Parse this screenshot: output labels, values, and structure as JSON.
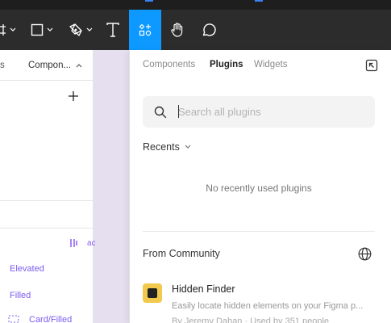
{
  "left_panel": {
    "tab_partial": "s",
    "tab_components": "Compon...",
    "assets_partial": "ac",
    "items": [
      "Elevated",
      "Filled",
      "Card/Filled"
    ]
  },
  "plugins_panel": {
    "tabs": [
      {
        "label": "Components",
        "active": false
      },
      {
        "label": "Plugins",
        "active": true
      },
      {
        "label": "Widgets",
        "active": false
      }
    ],
    "search": {
      "placeholder": "Search all plugins",
      "value": ""
    },
    "recents": {
      "label": "Recents",
      "empty_message": "No recently used plugins"
    },
    "community": {
      "label": "From Community",
      "plugins": [
        {
          "name": "Hidden Finder",
          "description": "Easily locate hidden elements on your Figma p...",
          "byline": "By Jeremy Dahan · Used by 351 people"
        }
      ]
    }
  },
  "colors": {
    "toolbar_bg": "#2c2c2c",
    "active_tool": "#0d99ff",
    "canvas": "#e6dff0",
    "component_purple": "#7c5cf0",
    "plugin_icon": "#f2c94c"
  },
  "icons": {
    "toolbar": [
      "frame-icon",
      "rectangle-icon",
      "pen-icon",
      "text-icon",
      "resources-icon",
      "hand-icon",
      "comment-icon"
    ],
    "panel": [
      "expand-icon",
      "search-icon",
      "chevron-down-icon",
      "globe-icon",
      "plus-icon"
    ]
  }
}
